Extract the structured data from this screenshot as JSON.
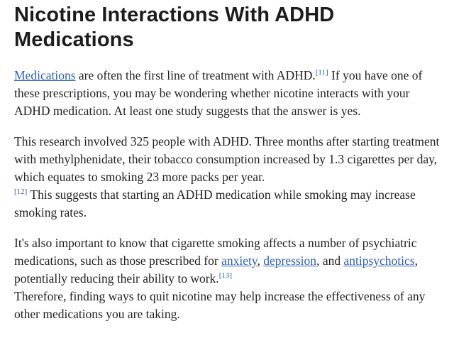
{
  "title": "Nicotine Interactions With ADHD Medications",
  "paragraph1": {
    "link": "Medications",
    "text1": " are often the first line of treatment with ADHD.",
    "ref": "[11]",
    "text2": " If you have one of these prescriptions, you may be wondering whether nicotine interacts with your ADHD medication. At least one study suggests that the answer is yes."
  },
  "paragraph2": {
    "text1": "This research involved 325 people with ADHD. Three months after starting treatment with methylphenidate, their tobacco consumption increased by 1.3 cigarettes per day, which equates to smoking 23 more packs per year.",
    "ref": "[12]",
    "text2": " This suggests that starting an ADHD medication while smoking may increase smoking rates."
  },
  "paragraph3": {
    "text1": "It's also important to know that cigarette smoking affects a number of psychiatric medications, such as those prescribed for ",
    "link_anxiety": "anxiety",
    "sep1": ", ",
    "link_depression": "depression",
    "sep2": ", and ",
    "link_antipsychotics": "antipsychotics",
    "text2": ", potentially reducing their ability to work.",
    "ref": "[13]",
    "text3": " Therefore, finding ways to quit nicotine may help increase the effectiveness of any other medications you are taking."
  },
  "colors": {
    "heading": "#1c1c1c",
    "body_text": "#222222",
    "link": "#2b5fb8"
  }
}
